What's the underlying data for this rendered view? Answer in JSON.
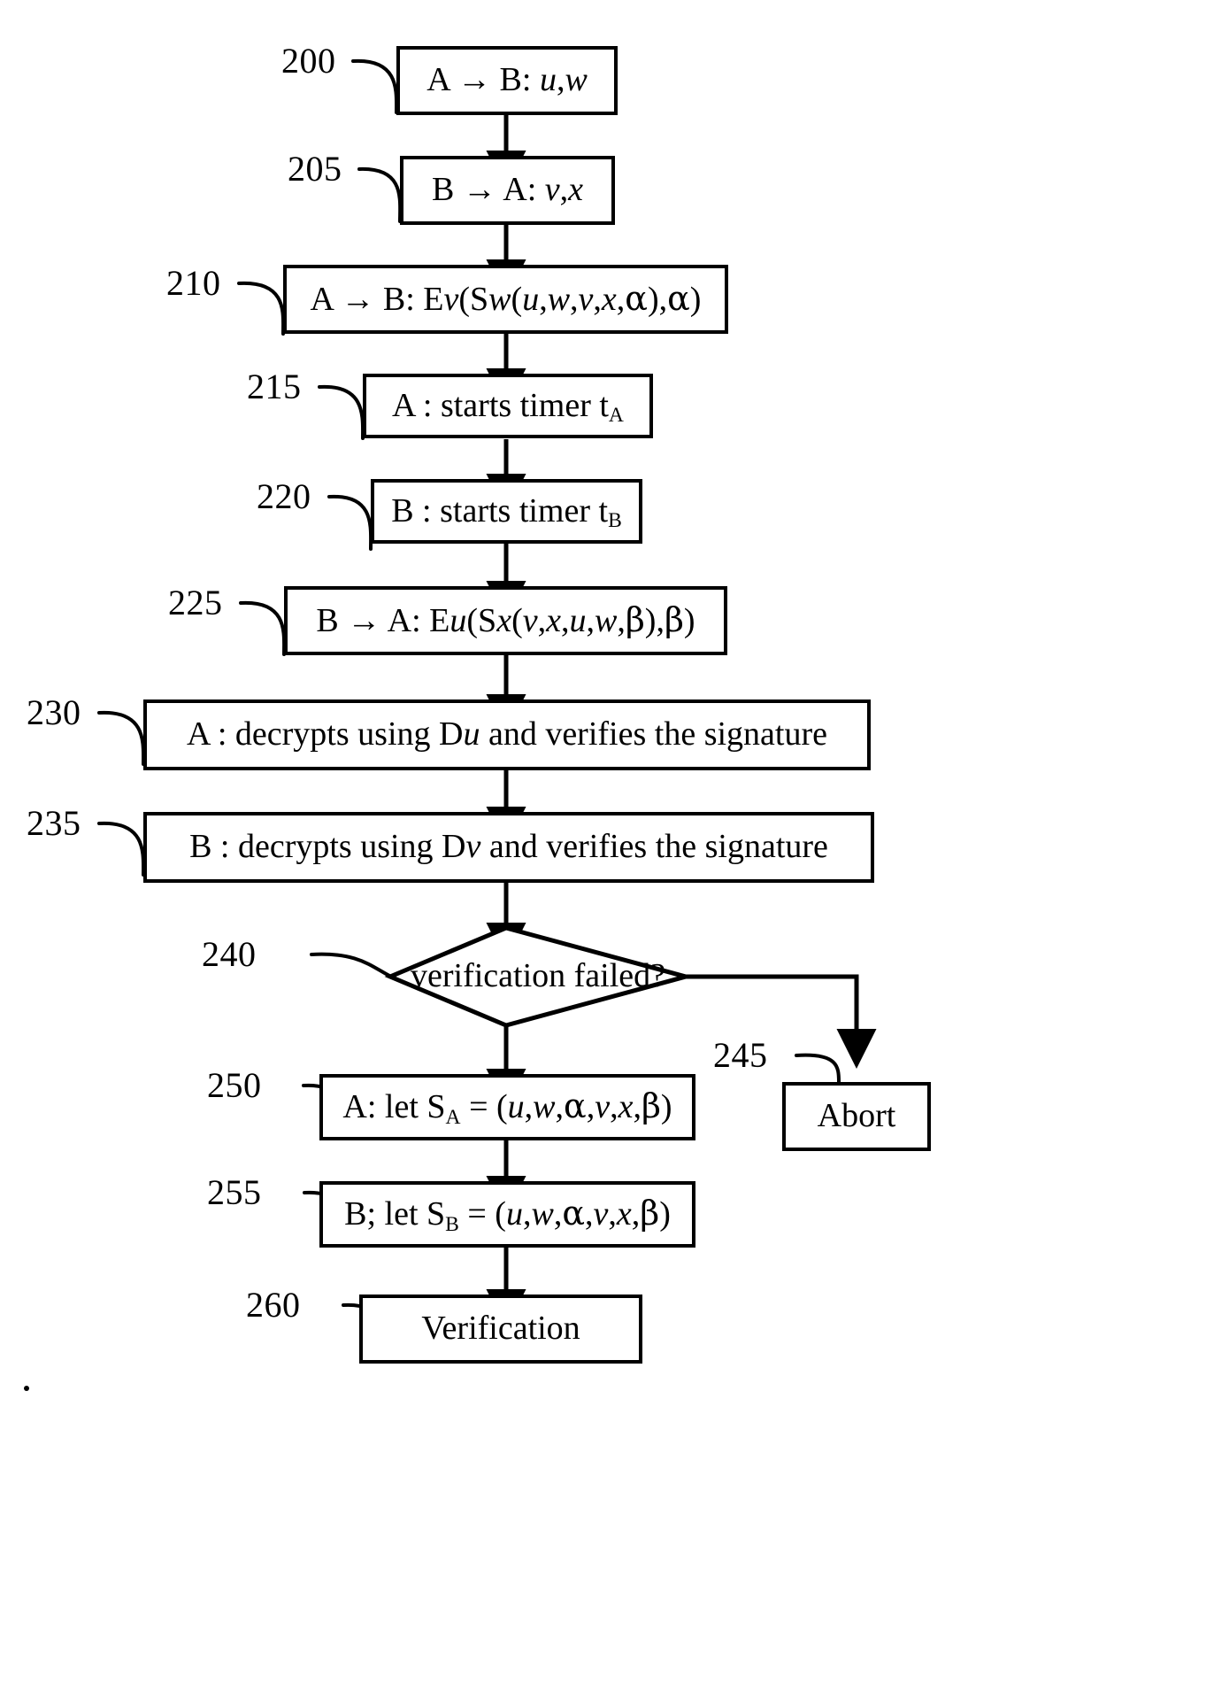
{
  "diagram": {
    "type": "patent-flowchart",
    "title": "Mutual authentication protocol flowchart",
    "background_color": "#ffffff",
    "line_color": "#000000"
  },
  "nodes": [
    {
      "id": "n200",
      "ref": "200",
      "shape": "rect",
      "text": "A → B: u,w",
      "html": "A → B: <i class=\"v\">u</i>,<i class=\"v\">w</i>"
    },
    {
      "id": "n205",
      "ref": "205",
      "shape": "rect",
      "text": "B → A: v,x",
      "html": "B → A: <i class=\"v\">v</i>,<i class=\"v\">x</i>"
    },
    {
      "id": "n210",
      "ref": "210",
      "shape": "rect",
      "text": "A → B: Ev(Sw(u,w,v,x,α),α)",
      "html": "A → B: E<i class=\"v\">v</i>(S<i class=\"v\">w</i>(<i class=\"v\">u</i>,<i class=\"v\">w</i>,<i class=\"v\">v</i>,<i class=\"v\">x</i>,<span class=\"grk\">α</span>),<span class=\"grk\">α</span>)"
    },
    {
      "id": "n215",
      "ref": "215",
      "shape": "rect",
      "text": "A : starts timer tA",
      "html": "A : starts timer t<sub>A</sub>"
    },
    {
      "id": "n220",
      "ref": "220",
      "shape": "rect",
      "text": "B : starts timer tB",
      "html": "B : starts timer t<sub>B</sub>"
    },
    {
      "id": "n225",
      "ref": "225",
      "shape": "rect",
      "text": "B → A: Eu(Sx(v,x,u,w,β),β)",
      "html": "B → A: E<i class=\"v\">u</i>(S<i class=\"v\">x</i>(<i class=\"v\">v</i>,<i class=\"v\">x</i>,<i class=\"v\">u</i>,<i class=\"v\">w</i>,<span class=\"grk\">β</span>),<span class=\"grk\">β</span>)"
    },
    {
      "id": "n230",
      "ref": "230",
      "shape": "rect",
      "text": "A : decrypts using Du and verifies the signature",
      "html": "A : decrypts using D<i class=\"v\">u</i> and verifies the signature"
    },
    {
      "id": "n235",
      "ref": "235",
      "shape": "rect",
      "text": "B : decrypts using Dv and verifies the signature",
      "html": "B : decrypts using D<i class=\"v\">v</i> and verifies the signature"
    },
    {
      "id": "n240",
      "ref": "240",
      "shape": "diamond",
      "text": "verification failed?",
      "html": "verification failed?"
    },
    {
      "id": "n245",
      "ref": "245",
      "shape": "rect",
      "text": "Abort",
      "html": "Abort"
    },
    {
      "id": "n250",
      "ref": "250",
      "shape": "rect",
      "text": "A: let SA = (u,w,α,v,x,β)",
      "html": "A: let S<sub>A</sub> = (<i class=\"v\">u</i>,<i class=\"v\">w</i>,<span class=\"grk\">α</span>,<i class=\"v\">v</i>,<i class=\"v\">x</i>,<span class=\"grk\">β</span>)"
    },
    {
      "id": "n255",
      "ref": "255",
      "shape": "rect",
      "text": "B; let SB = (u,w,α,v,x,β)",
      "html": "B; let S<sub>B</sub> = (<i class=\"v\">u</i>,<i class=\"v\">w</i>,<span class=\"grk\">α</span>,<i class=\"v\">v</i>,<i class=\"v\">x</i>,<span class=\"grk\">β</span>)"
    },
    {
      "id": "n260",
      "ref": "260",
      "shape": "rect",
      "text": "Verification",
      "html": "Verification"
    }
  ],
  "refs": {
    "r200": "200",
    "r205": "205",
    "r210": "210",
    "r215": "215",
    "r220": "220",
    "r225": "225",
    "r230": "230",
    "r235": "235",
    "r240": "240",
    "r245": "245",
    "r250": "250",
    "r255": "255",
    "r260": "260"
  }
}
